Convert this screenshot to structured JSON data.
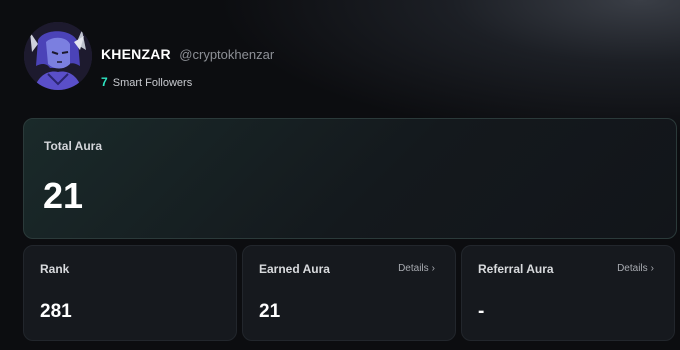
{
  "profile": {
    "name": "KHENZAR",
    "handle": "@cryptokhenzar",
    "smart_followers_count": "7",
    "smart_followers_label": "Smart Followers"
  },
  "total_aura": {
    "label": "Total Aura",
    "value": "21"
  },
  "rank": {
    "label": "Rank",
    "value": "281"
  },
  "earned_aura": {
    "label": "Earned Aura",
    "details_label": "Details",
    "value": "21"
  },
  "referral_aura": {
    "label": "Referral Aura",
    "details_label": "Details",
    "value": "-"
  },
  "icons": {
    "details_chevron": "chevron-right-icon"
  },
  "colors": {
    "accent": "#2ee6c3",
    "background": "#0c0d10",
    "card": "#16191e"
  }
}
